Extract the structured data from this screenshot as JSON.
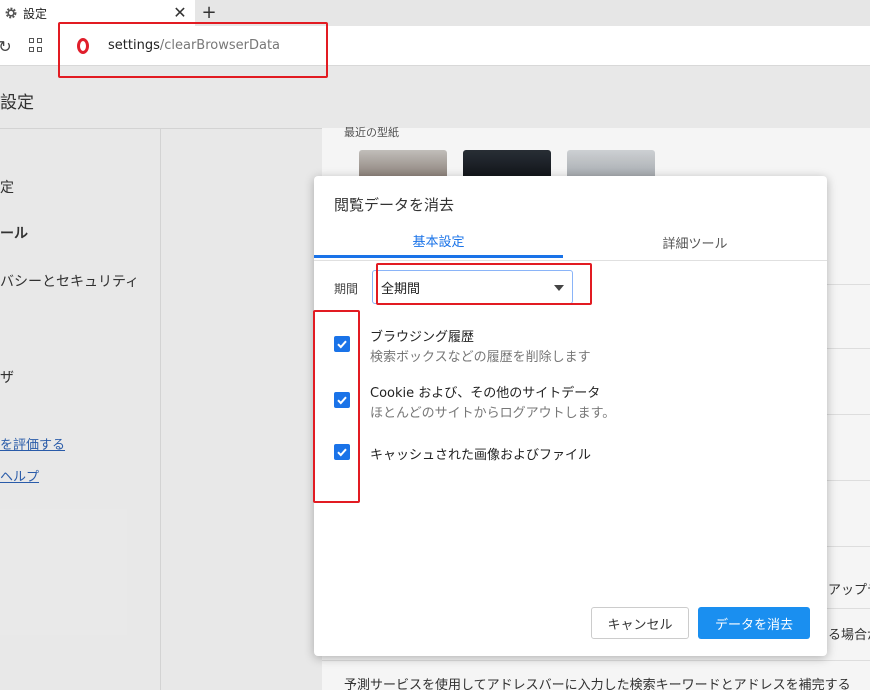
{
  "browser": {
    "tab_title": "設定",
    "close_glyph": "✕",
    "new_tab_glyph": "+",
    "reload_glyph": "↻",
    "url_host": "settings",
    "url_path": "/clearBrowserData"
  },
  "settings_page": {
    "title": "設定",
    "sidebar": [
      "定",
      "ール",
      "バシーとセキュリティ",
      "ザ"
    ],
    "links": [
      "を評価する",
      "ヘルプ"
    ],
    "recent_label": "最近の型紙",
    "rows": [
      "アップデ",
      "る場合が",
      "予測サービスを使用してアドレスバーに入力した検索キーワードとアドレスを補完する"
    ]
  },
  "dialog": {
    "title": "閲覧データを消去",
    "tabs": [
      {
        "label": "基本設定",
        "active": true
      },
      {
        "label": "詳細ツール",
        "active": false
      }
    ],
    "period": {
      "label": "期間",
      "value": "全期間"
    },
    "options": [
      {
        "title": "ブラウジング履歴",
        "subtitle": "検索ボックスなどの履歴を削除します",
        "checked": true
      },
      {
        "title": "Cookie および、その他のサイトデータ",
        "subtitle": "ほとんどのサイトからログアウトします。",
        "checked": true
      },
      {
        "title": "キャッシュされた画像およびファイル",
        "subtitle": "",
        "checked": true
      }
    ],
    "buttons": {
      "cancel": "キャンセル",
      "clear": "データを消去"
    }
  },
  "colors": {
    "accent": "#1a73e8",
    "annotation": "#e21b22",
    "clear_button": "#1a8ff0"
  }
}
